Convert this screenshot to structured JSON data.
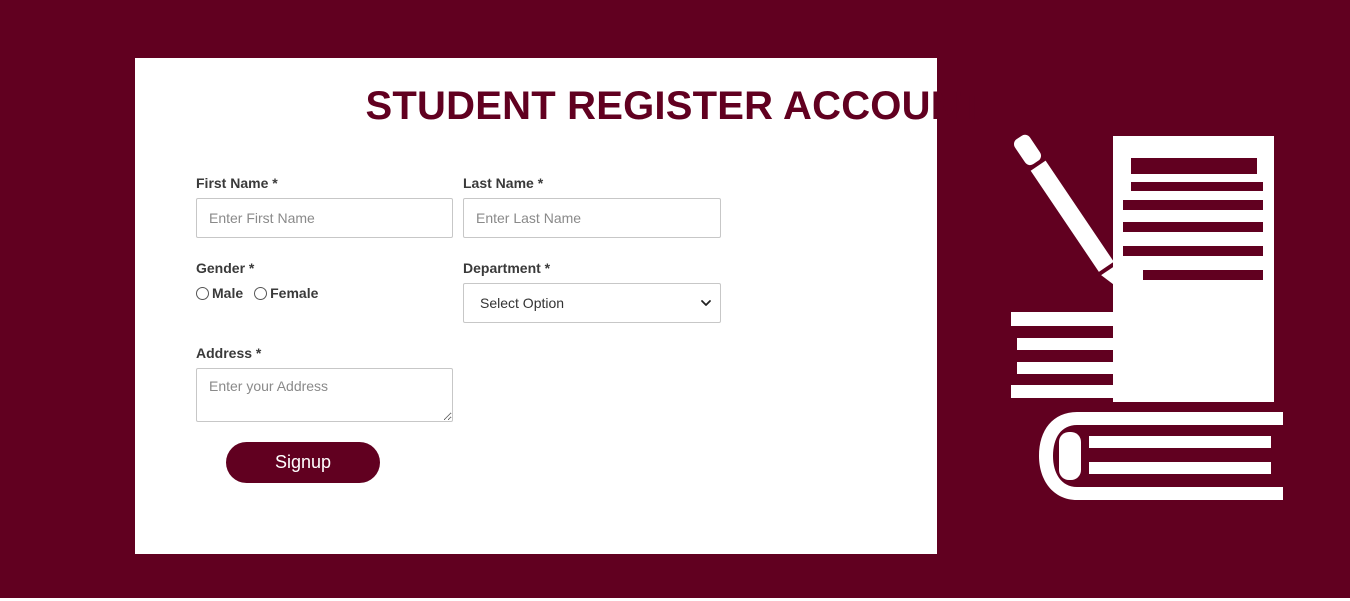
{
  "form": {
    "title": "STUDENT REGISTER ACCOUNT",
    "first_name": {
      "label": "First Name *",
      "value": "",
      "placeholder": "Enter First Name"
    },
    "last_name": {
      "label": "Last Name *",
      "value": "",
      "placeholder": "Enter Last Name"
    },
    "gender": {
      "label": "Gender *",
      "options": [
        {
          "label": "Male",
          "checked": false
        },
        {
          "label": "Female",
          "checked": false
        }
      ]
    },
    "department": {
      "label": "Department *",
      "selected": "Select Option"
    },
    "address": {
      "label": "Address *",
      "value": "",
      "placeholder": "Enter your Address"
    },
    "submit_label": "Signup"
  },
  "illustration": {
    "icon": "notebook-pencil-icon"
  },
  "colors": {
    "brand": "#610020",
    "background": "#610020",
    "card": "#ffffff",
    "label_text": "#3a3a3a",
    "border": "#c7c7c7"
  }
}
